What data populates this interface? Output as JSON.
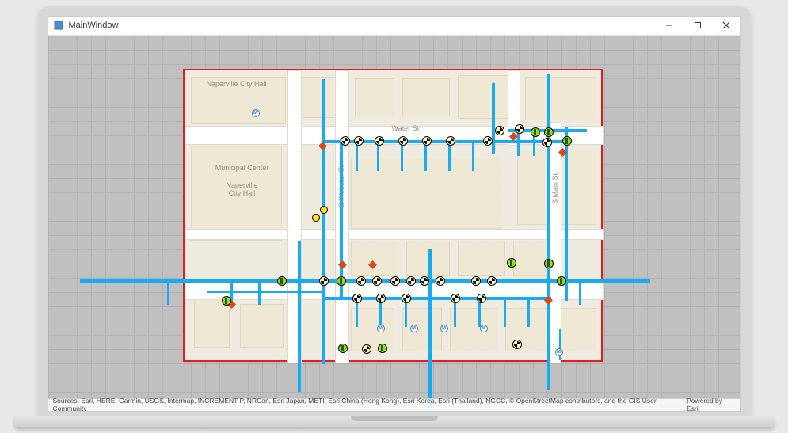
{
  "window": {
    "title": "MainWindow"
  },
  "map": {
    "labels": {
      "city_hall_top": "Naperville City Hall",
      "municipal_center": "Municipal Center",
      "city_hall_side": "Naperville\nCity Hall",
      "water_st": "Water St",
      "webster_st": "S Webster St",
      "main_st": "S Main St"
    },
    "attribution_sources": "Sources: Esri, HERE, Garmin, USGS, Intermap, INCREMENT P, NRCan, Esri Japan, METI, Esri China (Hong Kong), Esri Korea, Esri (Thailand), NGCC, © OpenStreetMap contributors, and the GIS User Community",
    "attribution_powered": "Powered by Esri"
  }
}
